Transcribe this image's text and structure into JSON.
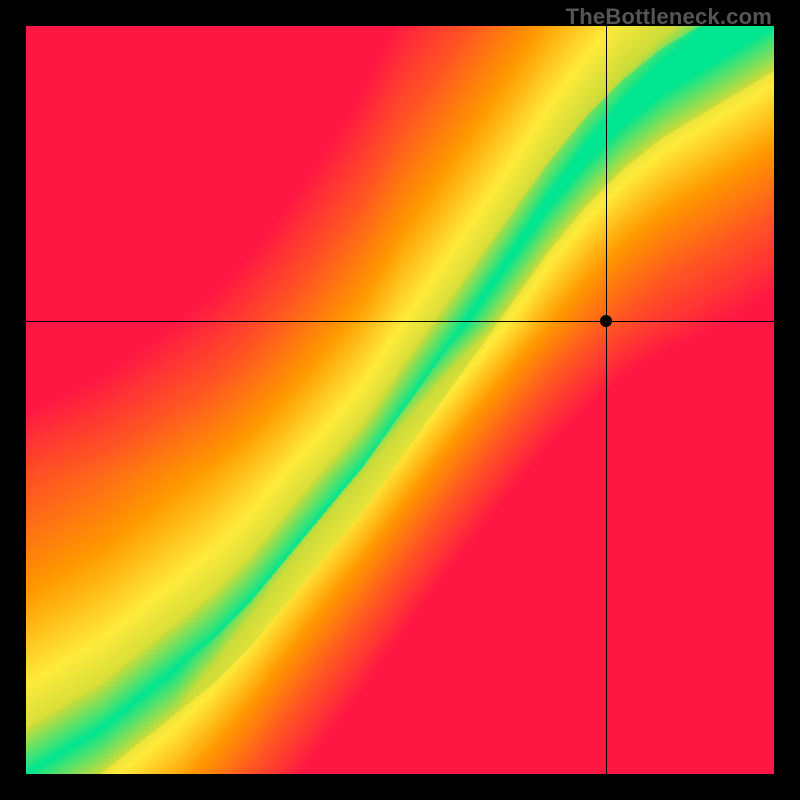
{
  "watermark": "TheBottleneck.com",
  "chart_data": {
    "type": "heatmap",
    "title": "",
    "xlabel": "",
    "ylabel": "",
    "xlim": [
      0,
      1
    ],
    "ylim": [
      0,
      1
    ],
    "crosshair": {
      "x": 0.775,
      "y": 0.605
    },
    "marker": {
      "x": 0.775,
      "y": 0.605
    },
    "ridge_points": [
      {
        "x": 0.0,
        "y": 0.0
      },
      {
        "x": 0.05,
        "y": 0.03
      },
      {
        "x": 0.1,
        "y": 0.06
      },
      {
        "x": 0.15,
        "y": 0.1
      },
      {
        "x": 0.2,
        "y": 0.14
      },
      {
        "x": 0.25,
        "y": 0.18
      },
      {
        "x": 0.3,
        "y": 0.23
      },
      {
        "x": 0.35,
        "y": 0.29
      },
      {
        "x": 0.4,
        "y": 0.35
      },
      {
        "x": 0.45,
        "y": 0.41
      },
      {
        "x": 0.5,
        "y": 0.48
      },
      {
        "x": 0.55,
        "y": 0.55
      },
      {
        "x": 0.6,
        "y": 0.62
      },
      {
        "x": 0.65,
        "y": 0.69
      },
      {
        "x": 0.7,
        "y": 0.76
      },
      {
        "x": 0.75,
        "y": 0.82
      },
      {
        "x": 0.8,
        "y": 0.87
      },
      {
        "x": 0.85,
        "y": 0.91
      },
      {
        "x": 0.9,
        "y": 0.94
      },
      {
        "x": 0.95,
        "y": 0.97
      },
      {
        "x": 1.0,
        "y": 1.0
      }
    ],
    "ridge_width": 0.06,
    "colormap": {
      "stops": [
        {
          "t": 0.0,
          "color": "#ff1744"
        },
        {
          "t": 0.3,
          "color": "#ff5722"
        },
        {
          "t": 0.55,
          "color": "#ff9800"
        },
        {
          "t": 0.78,
          "color": "#ffeb3b"
        },
        {
          "t": 0.92,
          "color": "#cddc39"
        },
        {
          "t": 1.0,
          "color": "#00e691"
        }
      ]
    },
    "corner_colors": {
      "bottom_left_origin": "#00e691",
      "top_left": "#ff1744",
      "bottom_right": "#ff1744",
      "top_right": "#ffb300"
    }
  }
}
